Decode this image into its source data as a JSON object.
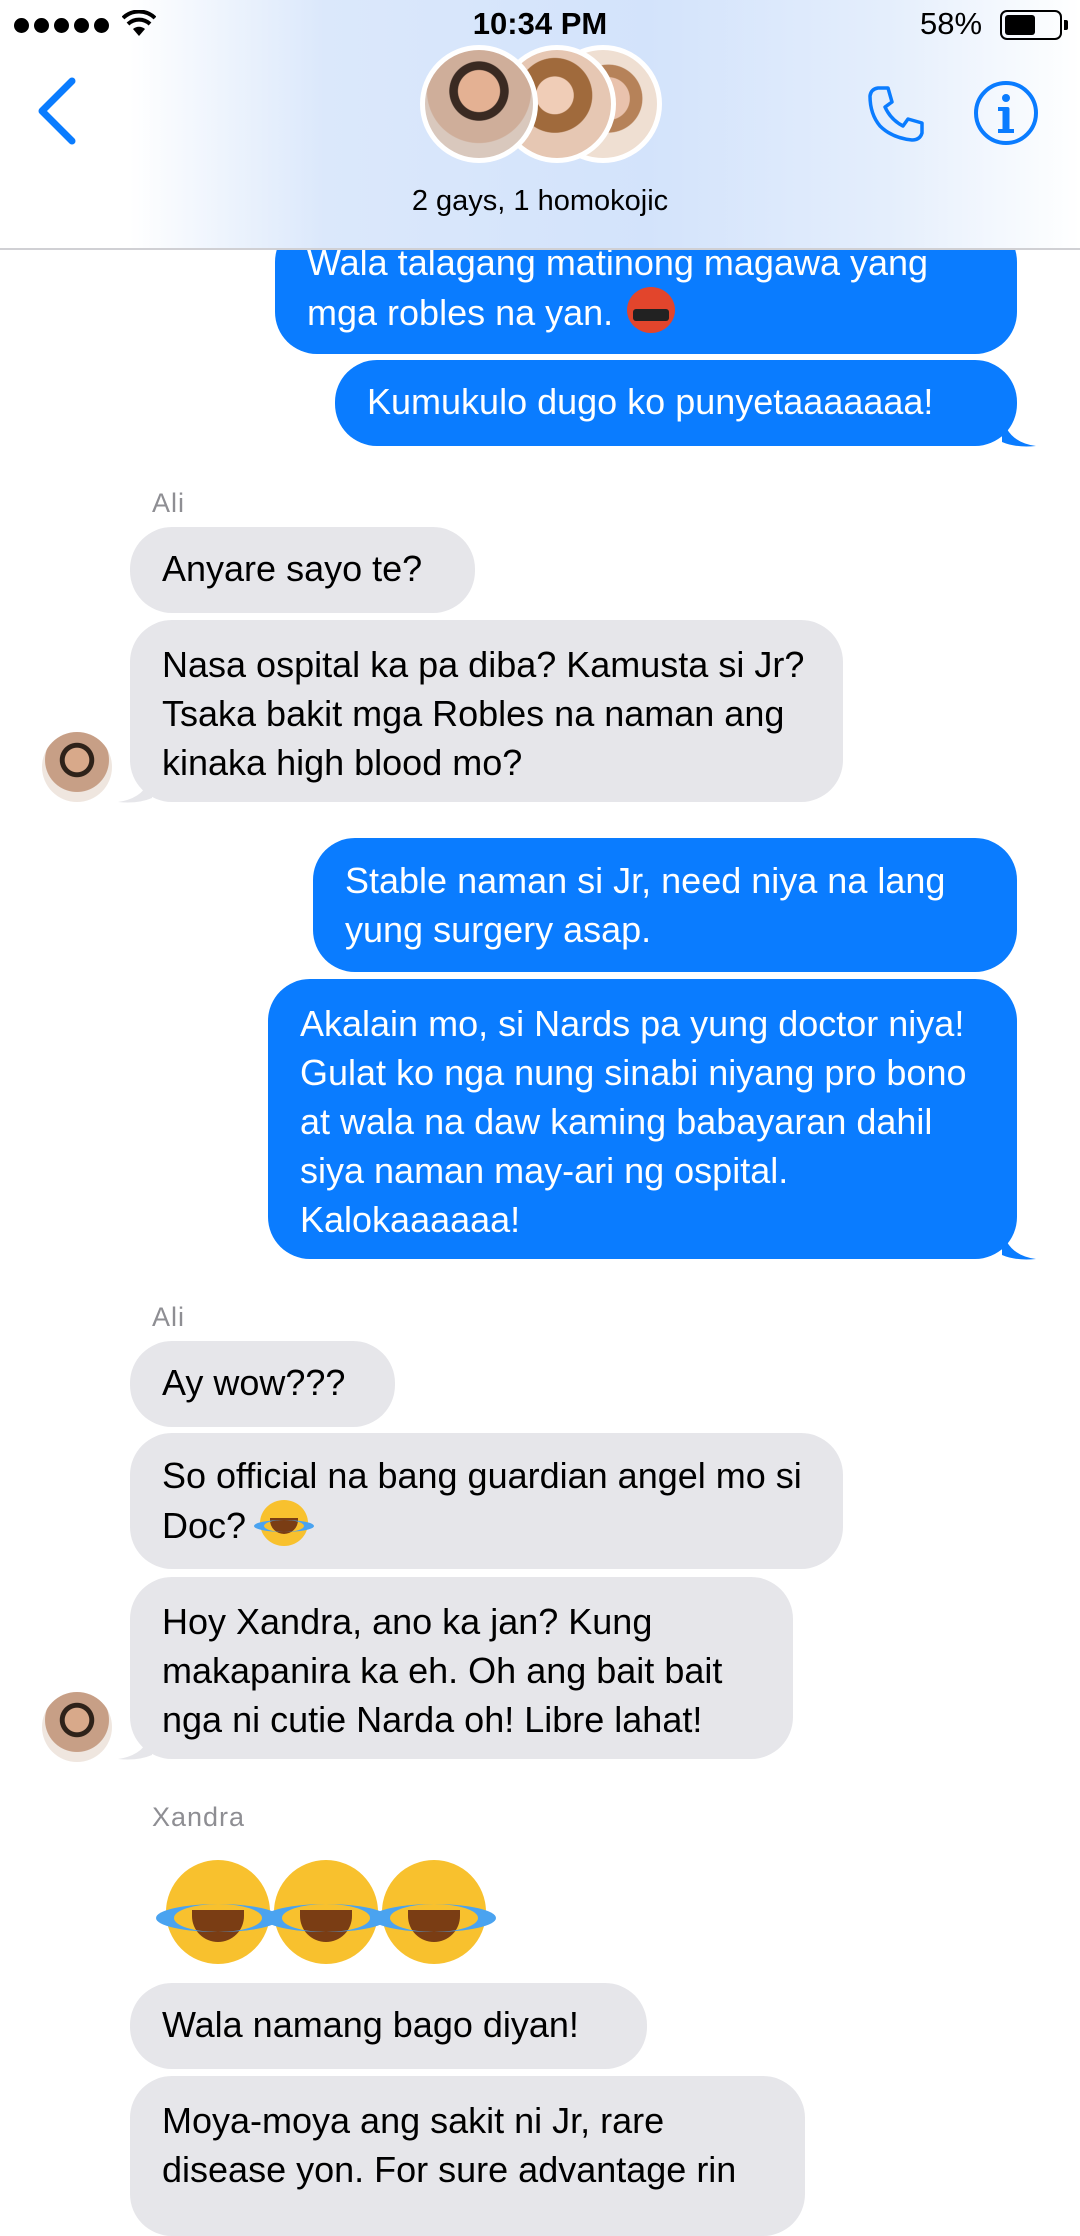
{
  "status": {
    "time": "10:34 PM",
    "battery": "58%"
  },
  "header": {
    "group_name": "2 gays, 1 homokojic"
  },
  "messages": [
    {
      "text": "Wala talagang matinong magawa yang mga robles na yan."
    },
    {
      "text": "Kumukulo dugo ko punyetaaaaaaa!"
    },
    {
      "text": "Anyare sayo te?"
    },
    {
      "text": "Nasa ospital ka pa diba? Kamusta si Jr? Tsaka bakit mga Robles na naman ang kinaka high blood mo?"
    },
    {
      "text": "Stable naman si Jr, need niya na lang yung surgery asap."
    },
    {
      "text": "Akalain mo, si Nards pa yung doctor niya! Gulat ko nga nung sinabi niyang pro bono at wala na daw kaming babayaran dahil siya naman may-ari ng ospital. Kalokaaaaaa!"
    },
    {
      "text": "Ay wow???"
    },
    {
      "text": "So official na bang guardian angel mo si Doc?"
    },
    {
      "text": "Hoy Xandra, ano ka jan? Kung makapanira ka eh. Oh ang bait bait nga ni cutie Narda oh! Libre lahat!"
    },
    {
      "text": "Wala namang bago diyan!"
    },
    {
      "text": "Moya-moya ang sakit ni Jr, rare disease yon. For sure advantage rin"
    }
  ],
  "senders": {
    "ali": "Ali",
    "xandra": "Xandra"
  },
  "emoji": {
    "angry": "face-with-symbols-on-mouth",
    "laugh": "face-with-tears-of-joy"
  },
  "colors": {
    "outgoing": "#0a7cff",
    "incoming": "#e6e6ea",
    "accent": "#0a7cff"
  }
}
